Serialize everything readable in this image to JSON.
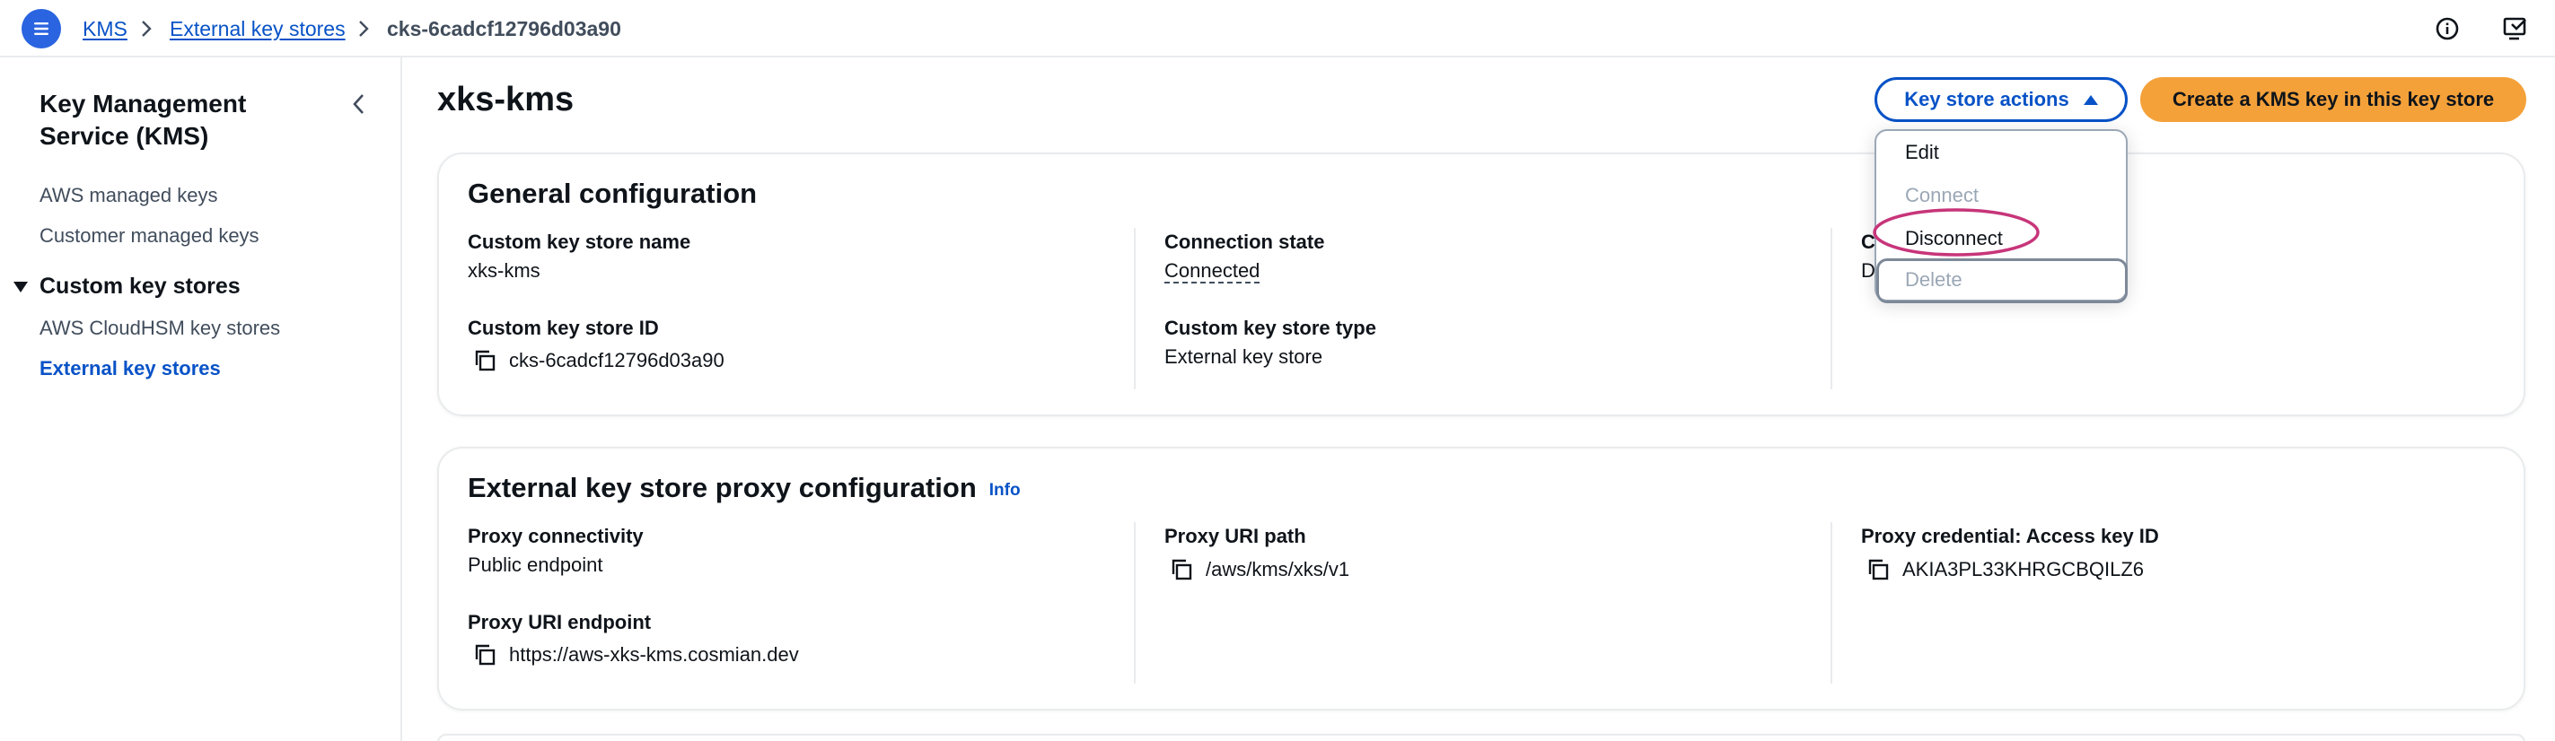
{
  "breadcrumb": {
    "items": [
      "KMS",
      "External key stores"
    ],
    "current": "cks-6cadcf12796d03a90"
  },
  "top_icons": [
    "info-icon",
    "feedback-icon"
  ],
  "sidebar": {
    "title": "Key Management Service (KMS)",
    "items": [
      "AWS managed keys",
      "Customer managed keys"
    ],
    "section": "Custom key stores",
    "section_items": [
      "AWS CloudHSM key stores",
      "External key stores"
    ],
    "active_item": "External key stores"
  },
  "page": {
    "title": "xks-kms",
    "actions_button": "Key store actions",
    "primary_button": "Create a KMS key in this key store"
  },
  "dropdown": {
    "items": [
      {
        "label": "Edit",
        "disabled": false
      },
      {
        "label": "Connect",
        "disabled": true
      },
      {
        "label": "Disconnect",
        "disabled": false
      },
      {
        "label": "Delete",
        "disabled": true
      }
    ],
    "highlight_color": "#c7357a"
  },
  "general": {
    "title": "General configuration",
    "name_label": "Custom key store name",
    "name_value": "xks-kms",
    "id_label": "Custom key store ID",
    "id_value": "cks-6cadcf12796d03a90",
    "state_label": "Connection state",
    "state_value": "Connected",
    "type_label": "Custom key store type",
    "type_value": "External key store",
    "col3_label_fragment": "C",
    "col3_value_fragment": "D"
  },
  "proxy": {
    "title": "External key store proxy configuration",
    "info": "Info",
    "connectivity_label": "Proxy connectivity",
    "connectivity_value": "Public endpoint",
    "endpoint_label": "Proxy URI endpoint",
    "endpoint_value": "https://aws-xks-kms.cosmian.dev",
    "path_label": "Proxy URI path",
    "path_value": "/aws/kms/xks/v1",
    "credential_label": "Proxy credential: Access key ID",
    "credential_value": "AKIA3PL33KHRGCBQILZ6"
  },
  "colors": {
    "link": "#0752c7",
    "primary_button": "#f4a13a",
    "menu_button": "#2a64e0"
  }
}
